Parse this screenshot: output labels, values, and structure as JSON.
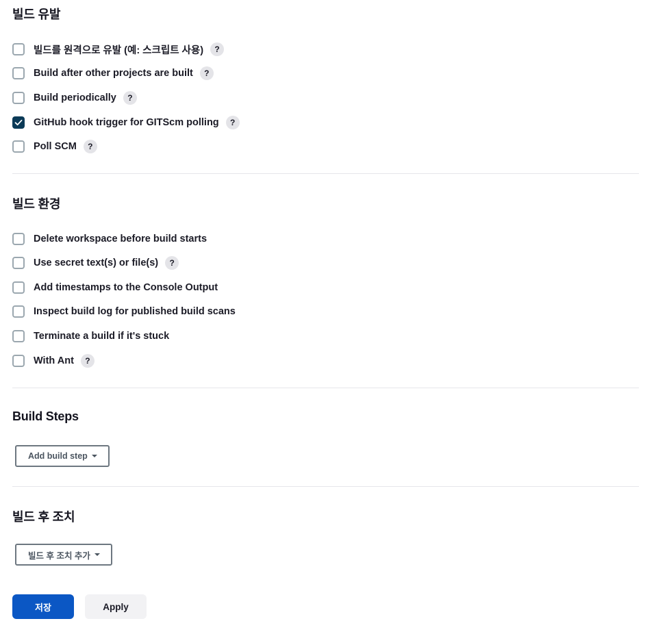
{
  "build_triggers": {
    "title": "빌드 유발",
    "options": [
      {
        "label": "빌드를 원격으로 유발 (예: 스크립트 사용)",
        "checked": false,
        "help": "?"
      },
      {
        "label": "Build after other projects are built",
        "checked": false,
        "help": "?"
      },
      {
        "label": "Build periodically",
        "checked": false,
        "help": "?"
      },
      {
        "label": "GitHub hook trigger for GITScm polling",
        "checked": true,
        "help": "?"
      },
      {
        "label": "Poll SCM",
        "checked": false,
        "help": "?"
      }
    ]
  },
  "build_environment": {
    "title": "빌드 환경",
    "options": [
      {
        "label": "Delete workspace before build starts",
        "checked": false
      },
      {
        "label": "Use secret text(s) or file(s)",
        "checked": false,
        "help": "?"
      },
      {
        "label": "Add timestamps to the Console Output",
        "checked": false
      },
      {
        "label": "Inspect build log for published build scans",
        "checked": false
      },
      {
        "label": "Terminate a build if it's stuck",
        "checked": false
      },
      {
        "label": "With Ant",
        "checked": false,
        "help": "?"
      }
    ]
  },
  "build_steps": {
    "title": "Build Steps",
    "add_label": "Add build step"
  },
  "post_build": {
    "title": "빌드 후 조치",
    "add_label": "빌드 후 조치 추가"
  },
  "actions": {
    "save_label": "저장",
    "apply_label": "Apply"
  },
  "colors": {
    "checked_fill": "#0b3a57",
    "primary_button": "#0b57c4"
  }
}
